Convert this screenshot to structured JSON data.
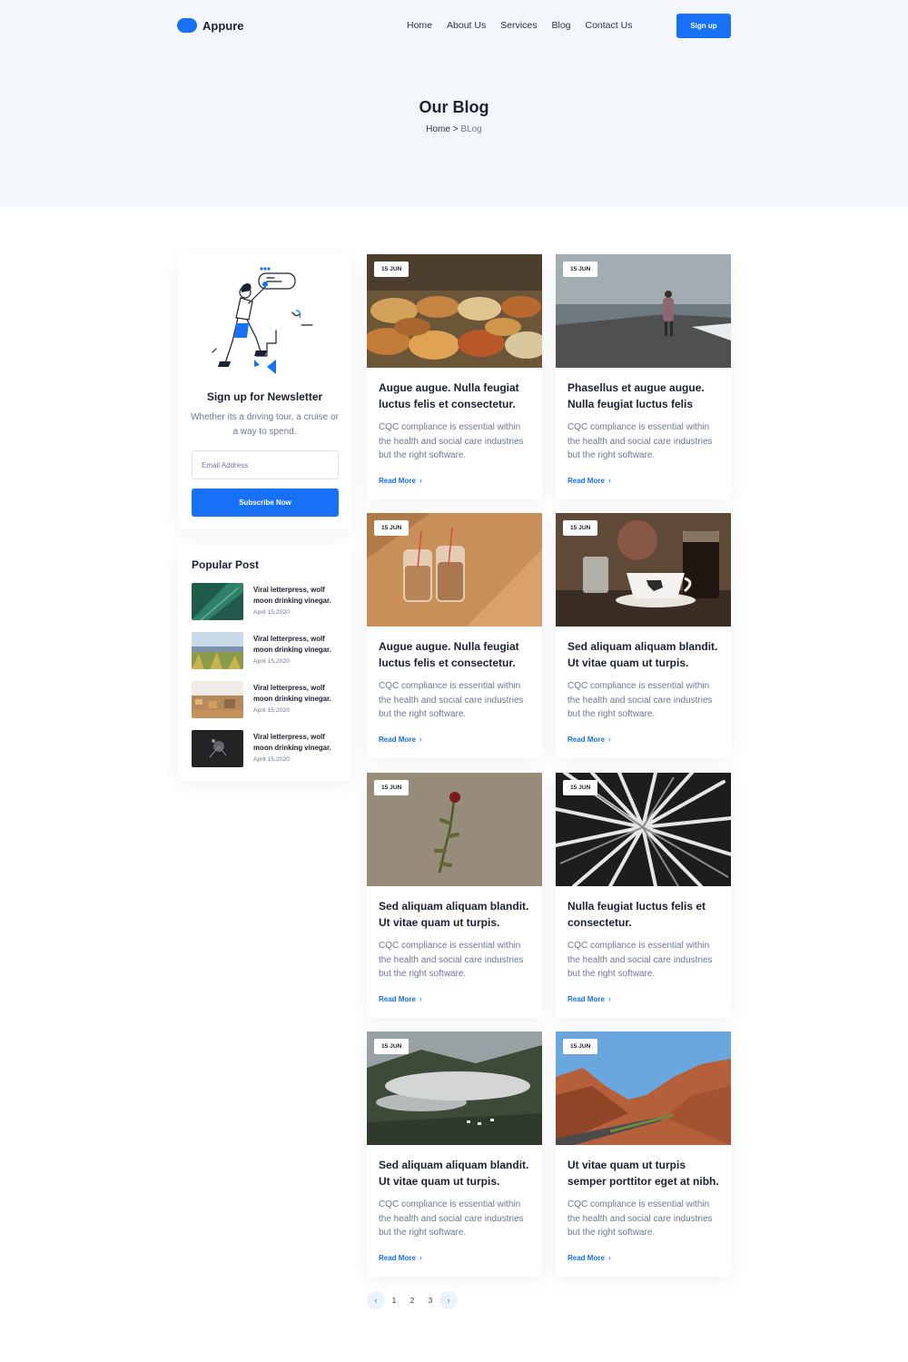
{
  "header": {
    "logo_text": "Appure",
    "nav": [
      "Home",
      "About Us",
      "Services",
      "Blog",
      "Contact Us"
    ],
    "signup_label": "Sign up",
    "brand_color": "#1770f5"
  },
  "hero": {
    "title": "Our Blog",
    "breadcrumb_home": "Home",
    "breadcrumb_sep": " > ",
    "breadcrumb_current": "BLog"
  },
  "newsletter": {
    "title": "Sign up for Newsletter",
    "text": "Whether its a driving tour, a cruise or a way to spend.",
    "email_placeholder": "Email Address",
    "button_label": "Subscribe Now"
  },
  "popular": {
    "title": "Popular Post",
    "items": [
      {
        "text": "Viral letterpress, wolf moon drinking vinegar.",
        "date": "April 15,2020",
        "thumb": "leaf"
      },
      {
        "text": "Viral letterpress, wolf moon drinking vinegar.",
        "date": "April 15,2020",
        "thumb": "meadow"
      },
      {
        "text": "Viral letterpress, wolf moon drinking vinegar.",
        "date": "April 15,2020",
        "thumb": "city"
      },
      {
        "text": "Viral letterpress, wolf moon drinking vinegar.",
        "date": "April 15,2020",
        "thumb": "dark-flower"
      }
    ]
  },
  "posts": [
    {
      "date": "15 JUN",
      "title": "Augue augue. Nulla feugiat luctus felis et consectetur.",
      "text": "CQC compliance is essential within the health and social care industries but the right software.",
      "read_more": "Read More",
      "image": "spice-market"
    },
    {
      "date": "15 JUN",
      "title": "Phasellus et augue augue. Nulla feugiat luctus felis",
      "text": "CQC compliance is essential within the health and social care industries but the right software.",
      "read_more": "Read More",
      "image": "sea-pier"
    },
    {
      "date": "15 JUN",
      "title": "Augue augue. Nulla feugiat luctus felis et consectetur.",
      "text": "CQC compliance is essential within the health and social care industries but the right software.",
      "read_more": "Read More",
      "image": "bubble-tea"
    },
    {
      "date": "15 JUN",
      "title": "Sed aliquam aliquam blandit. Ut vitae quam ut turpis.",
      "text": "CQC compliance is essential within the health and social care industries but the right software.",
      "read_more": "Read More",
      "image": "coffee-cup"
    },
    {
      "date": "15 JUN",
      "title": "Sed aliquam aliquam blandit. Ut vitae quam ut turpis.",
      "text": "CQC compliance is essential within the health and social care industries but the right software.",
      "read_more": "Read More",
      "image": "rose-on-ground"
    },
    {
      "date": "15 JUN",
      "title": "Nulla feugiat luctus felis et consectetur.",
      "text": "CQC compliance is essential within the health and social care industries but the right software.",
      "read_more": "Read More",
      "image": "abstract-spikes"
    },
    {
      "date": "15 JUN",
      "title": "Sed aliquam aliquam blandit. Ut vitae quam ut turpis.",
      "text": "CQC compliance is essential within the health and social care industries but the right software.",
      "read_more": "Read More",
      "image": "misty-valley"
    },
    {
      "date": "15 JUN",
      "title": "Ut vitae quam ut turpis semper porttitor eget at nibh.",
      "text": "CQC compliance is essential within the health and social care industries but the right software.",
      "read_more": "Read More",
      "image": "red-canyon-road"
    }
  ],
  "pagination": {
    "prev_icon": "chevron-left-icon",
    "pages": [
      "1",
      "2",
      "3"
    ],
    "next_icon": "chevron-right-icon"
  }
}
